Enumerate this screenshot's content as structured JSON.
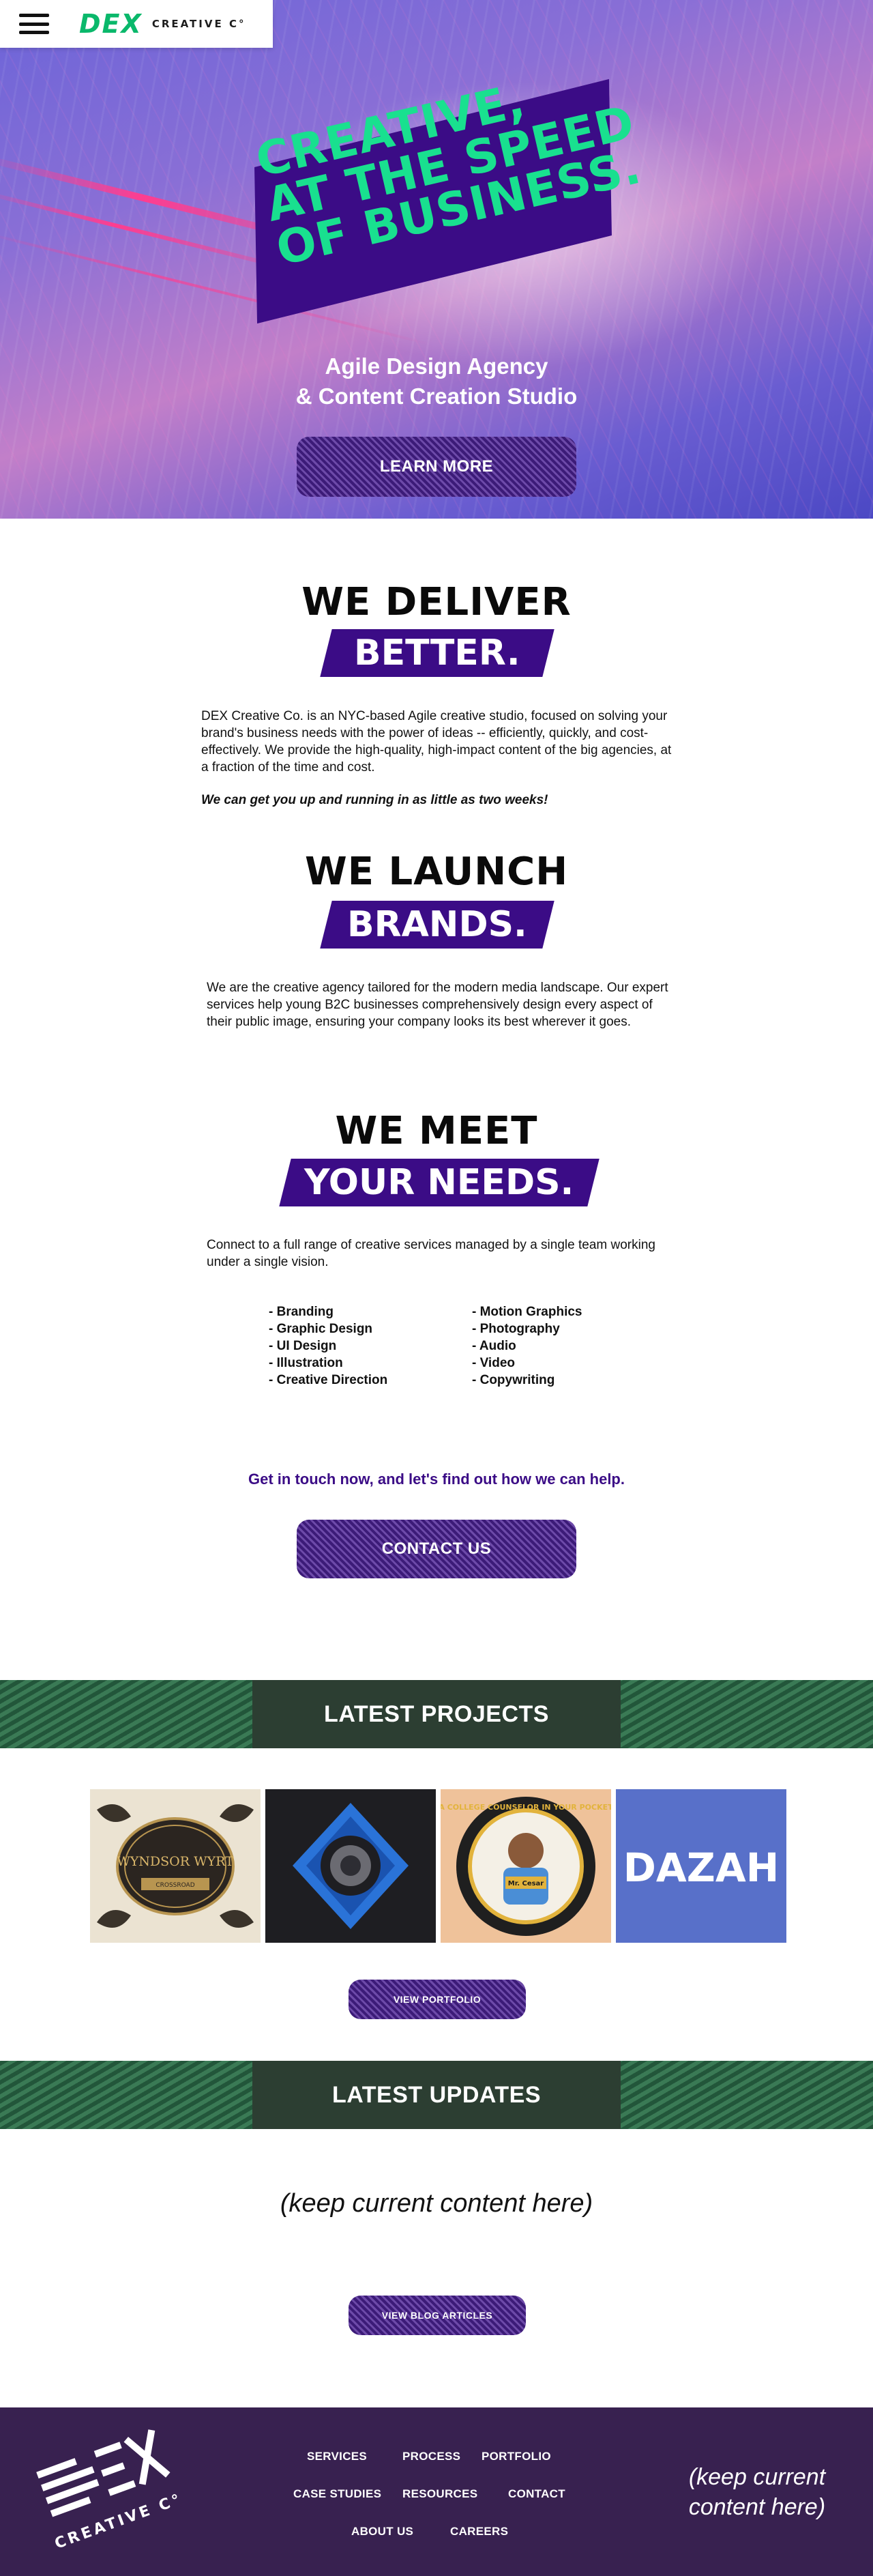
{
  "header": {
    "menu_icon": "hamburger-menu-icon",
    "logo_mark": "DEX",
    "logo_text": "CREATIVE C°"
  },
  "hero": {
    "headline": [
      "CREATIVE,",
      "AT THE SPEED",
      "OF BUSINESS."
    ],
    "subtitle_line1": "Agile Design Agency",
    "subtitle_line2": "& Content Creation Studio",
    "cta_label": "LEARN MORE"
  },
  "deliver": {
    "title": "WE DELIVER",
    "ribbon": "BETTER.",
    "body": "DEX Creative Co. is an NYC-based Agile creative studio, focused on solving your brand's business needs with the power of ideas -- efficiently, quickly, and cost-effectively. We provide the high-quality, high-impact content of the big agencies, at a fraction of the time and cost.",
    "emphasis": "We can get you up and running in as little as two weeks!"
  },
  "launch": {
    "title": "WE LAUNCH",
    "ribbon": "BRANDS.",
    "body": "We are the creative agency tailored for the modern media landscape. Our expert services help young B2C businesses comprehensively design every aspect of their public image, ensuring your company looks its best wherever it goes."
  },
  "needs": {
    "title": "WE MEET",
    "ribbon": "YOUR NEEDS.",
    "body": "Connect to a full range of creative services managed by a single team working under a single vision.",
    "services_left": [
      "- Branding",
      "- Graphic Design",
      "- UI Design",
      "- Illustration",
      "- Creative Direction"
    ],
    "services_right": [
      "- Motion Graphics",
      "- Photography",
      "- Audio",
      "- Video",
      "- Copywriting"
    ]
  },
  "cta": {
    "text": "Get in touch now, and let's find out how we can help.",
    "button": "CONTACT US"
  },
  "projects": {
    "title": "LATEST PROJECTS",
    "items": [
      {
        "name": "WYNDSOR WYRT",
        "sub": "CROSSROAD",
        "bg": "#e8e0cf"
      },
      {
        "name": "eye-logo",
        "bg": "#1e1e22"
      },
      {
        "name": "A COLLEGE COUNSELOR IN YOUR POCKET",
        "badge": "Mr. Cesar",
        "bg": "#f0c9a0"
      },
      {
        "name": "DAZAH",
        "bg": "#5870c9"
      }
    ],
    "button": "VIEW PORTFOLIO"
  },
  "updates": {
    "title": "LATEST UPDATES",
    "placeholder": "(keep current content here)",
    "button": "VIEW BLOG ARTICLES"
  },
  "footer": {
    "logo_mark": "DEX",
    "logo_text": "CREATIVE C°",
    "links": [
      "SERVICES",
      "PROCESS",
      "PORTFOLIO",
      "CASE STUDIES",
      "RESOURCES",
      "CONTACT",
      "ABOUT US",
      "CAREERS"
    ],
    "placeholder_line1": "(keep current",
    "placeholder_line2": "content here)"
  },
  "colors": {
    "accent_green": "#0bb765",
    "headline_green": "#19e08f",
    "brand_purple": "#3b0c86",
    "footer_purple": "#382150",
    "band_green": "#2c3e32"
  }
}
